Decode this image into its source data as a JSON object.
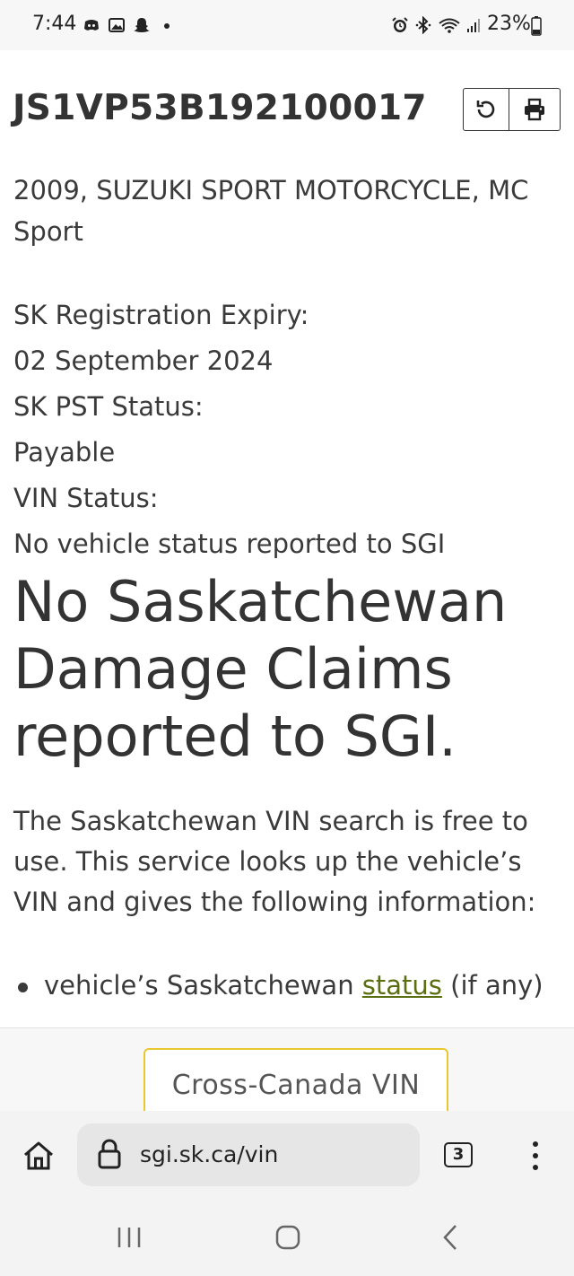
{
  "status_bar": {
    "time": "7:44",
    "battery": "23%",
    "icons": [
      "discord-icon",
      "gallery-icon",
      "snapchat-icon",
      "dot-icon",
      "alarm-icon",
      "bluetooth-icon",
      "wifi-icon",
      "signal-icon",
      "battery-icon"
    ]
  },
  "header": {
    "vin": "JS1VP53B192100017",
    "refresh_icon": "refresh-icon",
    "print_icon": "print-icon"
  },
  "vehicle": {
    "description_line1": "2009, SUZUKI SPORT MOTORCYCLE, MC",
    "description_line2": "Sport",
    "reg_expiry_label": "SK Registration Expiry:",
    "reg_expiry_value": "02 September 2024",
    "pst_label": "SK PST Status:",
    "pst_value": "Payable",
    "vin_status_label": "VIN Status:",
    "vin_status_value": "No vehicle status reported to SGI"
  },
  "claims": {
    "line1": "No Saskatchewan",
    "line2": "Damage Claims",
    "line3": "reported to SGI."
  },
  "info": {
    "line1": "The Saskatchewan VIN search is free to",
    "line2": "use. This service looks up the vehicle’s",
    "line3": "VIN and gives the following information:",
    "bullet_prefix": "vehicle’s Saskatchewan ",
    "bullet_link": "status",
    "bullet_suffix": " (if any)"
  },
  "cta": {
    "label": "Cross-Canada VIN"
  },
  "browser": {
    "url": "sgi.sk.ca/vin",
    "tab_count": "3",
    "accent_color": "#e8c82e",
    "link_color": "#5a6f12"
  }
}
